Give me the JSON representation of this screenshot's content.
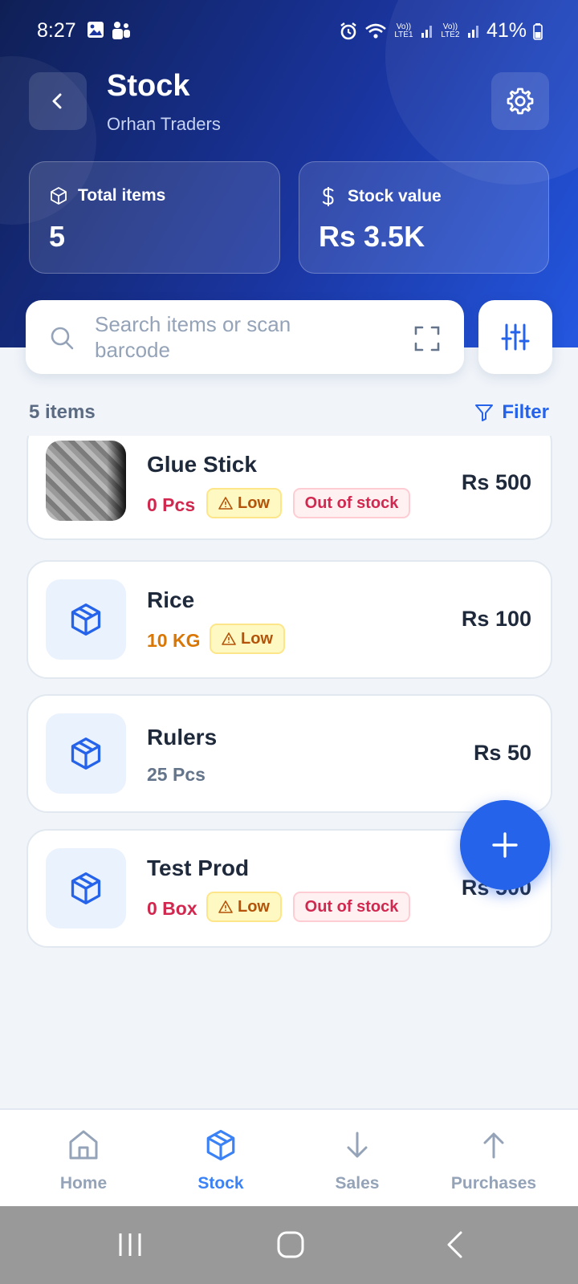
{
  "status_bar": {
    "time": "8:27",
    "battery": "41%",
    "sim1": "Vo)) LTE1",
    "sim2": "Vo)) LTE2",
    "icons": [
      "image-icon",
      "teams-icon",
      "alarm-icon",
      "wifi-icon",
      "signal-icon",
      "battery-icon"
    ]
  },
  "header": {
    "title": "Stock",
    "subtitle": "Orhan Traders",
    "back_icon": "chevron-left-icon",
    "settings_icon": "gear-icon"
  },
  "stats": [
    {
      "label": "Total items",
      "value": "5",
      "icon": "box-icon"
    },
    {
      "label": "Stock value",
      "value": "Rs 3.5K",
      "icon": "dollar-icon"
    }
  ],
  "search": {
    "placeholder": "Search items or scan barcode",
    "scan_icon": "scan-icon",
    "filter_icon": "sliders-icon"
  },
  "list_header": {
    "count": "5 items",
    "filter_label": "Filter"
  },
  "items": [
    {
      "name": "Glue Stick",
      "qty": "0 Pcs",
      "qty_status": "red",
      "badges": [
        "Low",
        "Out of stock"
      ],
      "price": "Rs 500",
      "thumb": "photo"
    },
    {
      "name": "Rice",
      "qty": "10 KG",
      "qty_status": "orange",
      "badges": [
        "Low"
      ],
      "price": "Rs 100",
      "thumb": "box-icon"
    },
    {
      "name": "Rulers",
      "qty": "25 Pcs",
      "qty_status": "gray",
      "badges": [],
      "price": "Rs 50",
      "thumb": "box-icon"
    },
    {
      "name": "Test Prod",
      "qty": "0 Box",
      "qty_status": "red",
      "badges": [
        "Low",
        "Out of stock"
      ],
      "price": "Rs 500",
      "thumb": "box-icon"
    }
  ],
  "fab": {
    "icon": "plus-icon"
  },
  "bottom_nav": [
    {
      "label": "Home",
      "icon": "home-icon",
      "active": false
    },
    {
      "label": "Stock",
      "icon": "box-icon",
      "active": true
    },
    {
      "label": "Sales",
      "icon": "arrow-down-icon",
      "active": false
    },
    {
      "label": "Purchases",
      "icon": "arrow-up-icon",
      "active": false
    }
  ],
  "colors": {
    "accent": "#2563eb",
    "header_dark": "#0f1f55",
    "header_light": "#2457e0",
    "out_of_stock": "#d1284f",
    "low_stock": "#d97706"
  }
}
